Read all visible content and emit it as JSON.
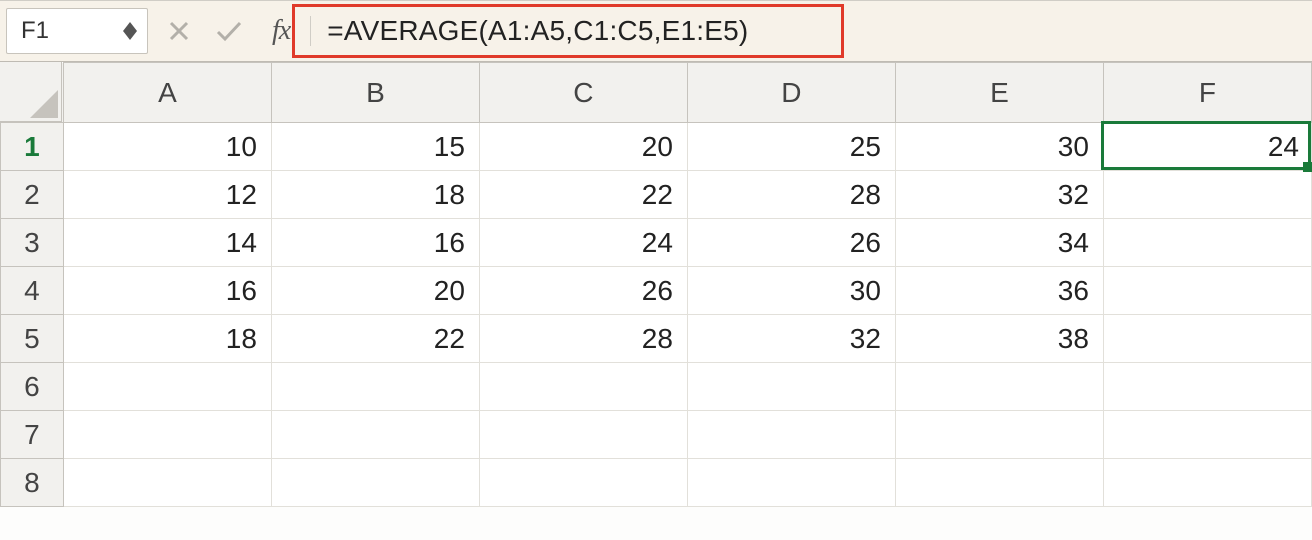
{
  "formula_bar": {
    "name_box": "F1",
    "fx_label": "fx",
    "formula": "=AVERAGE(A1:A5,C1:C5,E1:E5)"
  },
  "columns": [
    "A",
    "B",
    "C",
    "D",
    "E",
    "F"
  ],
  "rows": [
    "1",
    "2",
    "3",
    "4",
    "5",
    "6",
    "7",
    "8"
  ],
  "active_cell": {
    "col": "F",
    "row": "1"
  },
  "cells": {
    "A1": "10",
    "B1": "15",
    "C1": "20",
    "D1": "25",
    "E1": "30",
    "F1": "24",
    "A2": "12",
    "B2": "18",
    "C2": "22",
    "D2": "28",
    "E2": "32",
    "A3": "14",
    "B3": "16",
    "C3": "24",
    "D3": "26",
    "E3": "34",
    "A4": "16",
    "B4": "20",
    "C4": "26",
    "D4": "30",
    "E4": "36",
    "A5": "18",
    "B5": "22",
    "C5": "28",
    "D5": "32",
    "E5": "38"
  }
}
